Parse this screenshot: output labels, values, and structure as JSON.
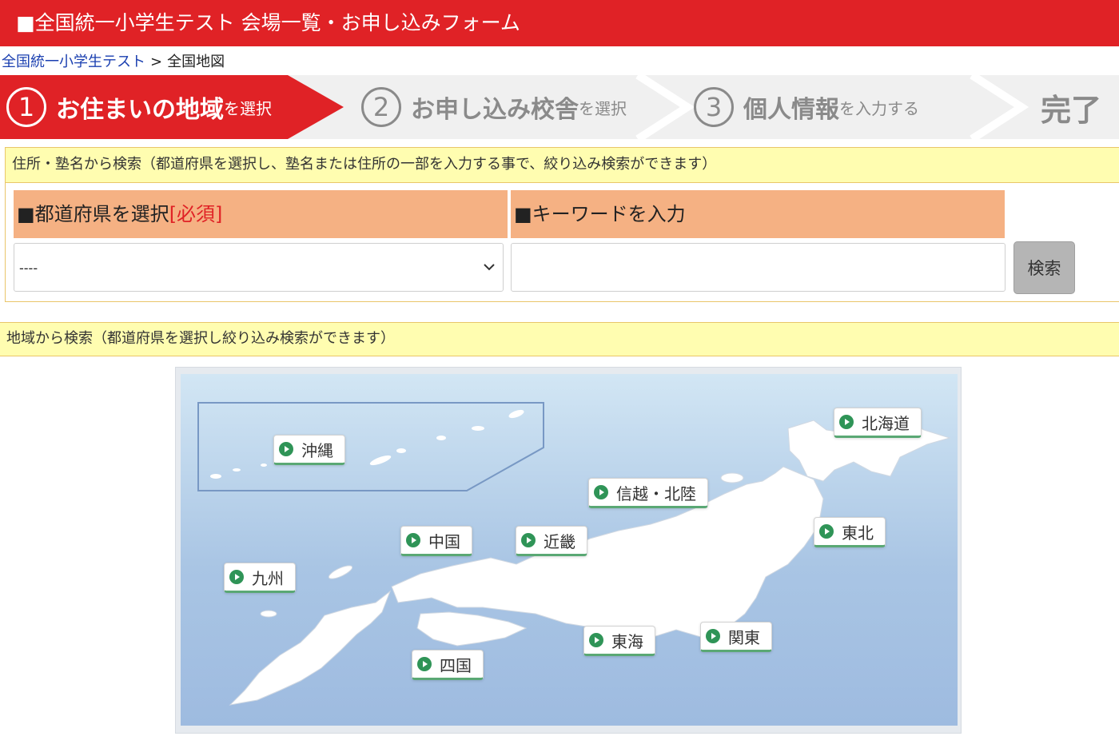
{
  "header": {
    "title": "■全国統一小学生テスト 会場一覧・お申し込みフォーム"
  },
  "breadcrumb": {
    "link": "全国統一小学生テスト",
    "separator": ">",
    "current": "全国地図"
  },
  "steps": [
    {
      "number": "1",
      "main": "お住まいの地域",
      "sub": "を選択"
    },
    {
      "number": "2",
      "main": "お申し込み校舎",
      "sub": "を選択"
    },
    {
      "number": "3",
      "main": "個人情報",
      "sub": "を入力する"
    },
    {
      "main": "完了"
    }
  ],
  "search": {
    "heading": "住所・塾名から検索（都道府県を選択し、塾名または住所の一部を入力する事で、絞り込み検索ができます）",
    "prefecture_label": "■都道府県を選択",
    "required": "[必須]",
    "keyword_label": "■キーワードを入力",
    "prefecture_value": "----",
    "keyword_value": "",
    "button": "検索"
  },
  "region_search": {
    "heading": "地域から検索（都道府県を選択し絞り込み検索ができます）",
    "regions": {
      "hokkaido": "北海道",
      "okinawa": "沖縄",
      "shinetsu": "信越・北陸",
      "tohoku": "東北",
      "chugoku": "中国",
      "kinki": "近畿",
      "kyushu": "九州",
      "tokai": "東海",
      "kanto": "関東",
      "shikoku": "四国"
    }
  },
  "colors": {
    "brand_red": "#e02226",
    "header_yellow": "#fffdb0",
    "label_orange": "#f5b183",
    "map_sea": "#a9c4e3",
    "button_green": "#2f9457"
  },
  "icons": {
    "region_button": "play-circle-icon",
    "select": "chevron-down-icon"
  }
}
